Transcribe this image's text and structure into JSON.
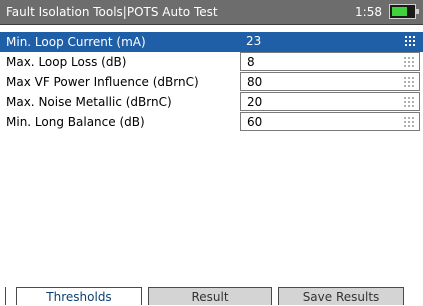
{
  "header": {
    "title": "Fault Isolation Tools|POTS Auto Test",
    "time": "1:58",
    "battery_color": "#3fd23a"
  },
  "settings": [
    {
      "label": "Min. Loop Current (mA)",
      "value": "23",
      "selected": true
    },
    {
      "label": "Max. Loop Loss (dB)",
      "value": "8",
      "selected": false
    },
    {
      "label": "Max VF Power Influence (dBrnC)",
      "value": "80",
      "selected": false
    },
    {
      "label": "Max. Noise Metallic (dBrnC)",
      "value": "20",
      "selected": false
    },
    {
      "label": "Min. Long Balance (dB)",
      "value": "60",
      "selected": false
    }
  ],
  "tabs": [
    {
      "label": "Thresholds",
      "active": true
    },
    {
      "label": "Result",
      "active": false
    },
    {
      "label": "Save Results",
      "active": false
    }
  ],
  "colors": {
    "selection": "#1f5fa8",
    "titlebar": "#6d6d6d",
    "active_tab_text": "#0e3f73"
  }
}
